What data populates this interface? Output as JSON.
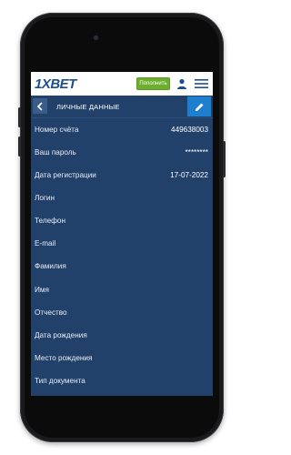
{
  "header": {
    "logo": "1XBET",
    "deposit_label": "Пополнить"
  },
  "subheader": {
    "title": "ЛИЧНЫЕ ДАННЫЕ"
  },
  "fields": [
    {
      "label": "Номер счёта",
      "value": "449638003"
    },
    {
      "label": "Ваш пароль",
      "value": "********"
    },
    {
      "label": "Дата регистрации",
      "value": "17-07-2022"
    },
    {
      "label": "Логин",
      "value": ""
    },
    {
      "label": "Телефон",
      "value": ""
    },
    {
      "label": "E-mail",
      "value": ""
    },
    {
      "label": "Фамилия",
      "value": ""
    },
    {
      "label": "Имя",
      "value": ""
    },
    {
      "label": "Отчество",
      "value": ""
    },
    {
      "label": "Дата рождения",
      "value": ""
    },
    {
      "label": "Место рождения",
      "value": ""
    },
    {
      "label": "Тип документа",
      "value": ""
    }
  ],
  "colors": {
    "background": "#21406a",
    "accent": "#1f7fcf",
    "deposit": "#6cae2d",
    "logo": "#1b4e92"
  },
  "icons": {
    "back": "chevron-left-icon",
    "edit": "pencil-icon",
    "user": "user-icon",
    "menu": "hamburger-menu-icon"
  }
}
